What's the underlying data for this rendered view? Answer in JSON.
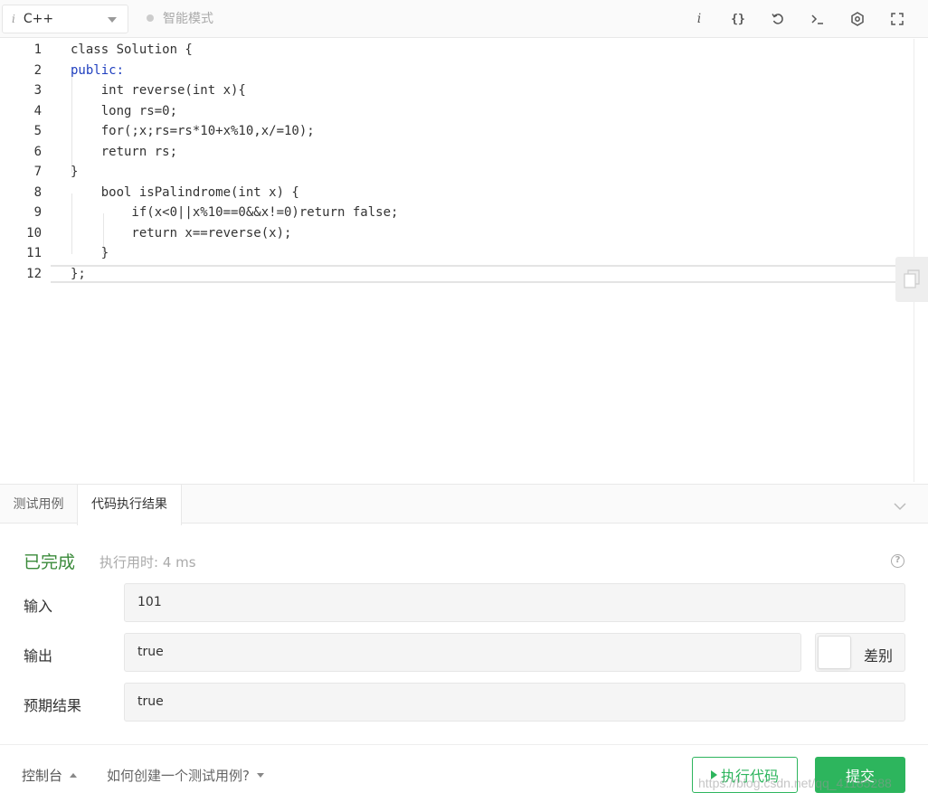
{
  "toolbar": {
    "language_icon_text": "i",
    "language": "C++",
    "smart_mode": "智能模式",
    "icons": [
      "info-icon",
      "format-icon",
      "reset-icon",
      "terminal-icon",
      "settings-icon",
      "fullscreen-icon"
    ],
    "info_glyph": "i",
    "format_glyph": "{}"
  },
  "editor": {
    "line_numbers": [
      "1",
      "2",
      "3",
      "4",
      "5",
      "6",
      "7",
      "8",
      "9",
      "10",
      "11",
      "12"
    ],
    "lines": [
      "class Solution {",
      "public:",
      "    int reverse(int x){",
      "    long rs=0;",
      "    for(;x;rs=rs*10+x%10,x/=10);",
      "    return rs;",
      "}",
      "    bool isPalindrome(int x) {",
      "        if(x<0||x%10==0&&x!=0)return false;",
      "        return x==reverse(x);",
      "    }",
      "};"
    ]
  },
  "tabs": {
    "items": [
      "测试用例",
      "代码执行结果"
    ],
    "active_index": 1
  },
  "result": {
    "status": "已完成",
    "time_text": "执行用时: 4 ms",
    "help_glyph": "?",
    "input_label": "输入",
    "input_value": "101",
    "output_label": "输出",
    "output_value": "true",
    "diff_label": "差别",
    "expected_label": "预期结果",
    "expected_value": "true"
  },
  "footer": {
    "console": "控制台",
    "howto": "如何创建一个测试用例?",
    "run": "执行代码",
    "submit": "提交",
    "watermark": "https://blog.csdn.net/qq_41185288"
  },
  "colors": {
    "accent_green": "#2db55d",
    "status_green": "#3a8a3a",
    "keyword_blue": "#1f3fbf",
    "number_green": "#0d9d6b"
  }
}
